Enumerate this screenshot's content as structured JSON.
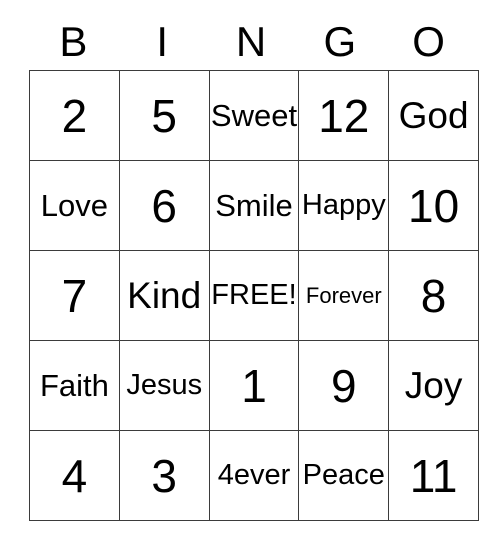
{
  "card": {
    "headers": [
      "B",
      "I",
      "N",
      "G",
      "O"
    ],
    "rows": [
      [
        {
          "text": "2",
          "size": "num"
        },
        {
          "text": "5",
          "size": "num"
        },
        {
          "text": "Sweet",
          "size": "word5"
        },
        {
          "text": "12",
          "size": "num"
        },
        {
          "text": "God",
          "size": "word3"
        }
      ],
      [
        {
          "text": "Love",
          "size": "word5"
        },
        {
          "text": "6",
          "size": "num"
        },
        {
          "text": "Smile",
          "size": "word5"
        },
        {
          "text": "Happy",
          "size": "word5b"
        },
        {
          "text": "10",
          "size": "num"
        }
      ],
      [
        {
          "text": "7",
          "size": "num"
        },
        {
          "text": "Kind",
          "size": "word3"
        },
        {
          "text": "FREE!",
          "size": "word5b"
        },
        {
          "text": "Forever",
          "size": "word7"
        },
        {
          "text": "8",
          "size": "num"
        }
      ],
      [
        {
          "text": "Faith",
          "size": "word5"
        },
        {
          "text": "Jesus",
          "size": "word5b"
        },
        {
          "text": "1",
          "size": "num"
        },
        {
          "text": "9",
          "size": "num"
        },
        {
          "text": "Joy",
          "size": "word3"
        }
      ],
      [
        {
          "text": "4",
          "size": "num"
        },
        {
          "text": "3",
          "size": "num"
        },
        {
          "text": "4ever",
          "size": "word5b"
        },
        {
          "text": "Peace",
          "size": "word5b"
        },
        {
          "text": "11",
          "size": "num"
        }
      ]
    ],
    "free_space": "FREE!",
    "colors": {
      "background": "#ffffff",
      "text": "#000000",
      "border": "#3b3b3b"
    }
  }
}
